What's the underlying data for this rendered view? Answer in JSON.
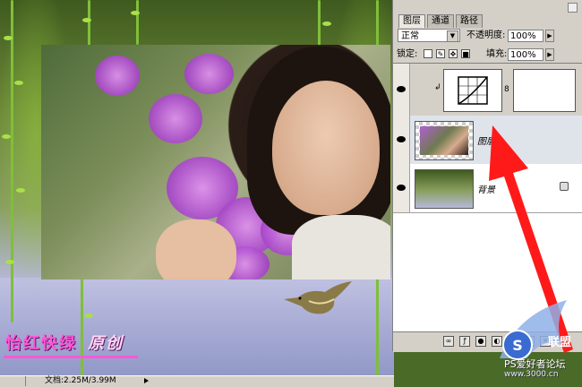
{
  "caption": {
    "main": "怡红快绿",
    "sub": "原创"
  },
  "status": {
    "doc_info": "文档:2.25M/3.99M"
  },
  "panel": {
    "tabs": [
      "图层",
      "通道",
      "路径"
    ],
    "blend_mode": "正常",
    "opacity_label": "不透明度:",
    "opacity_value": "100%",
    "lock_label": "锁定:",
    "fill_label": "填充:",
    "fill_value": "100%",
    "layers": [
      {
        "name": "",
        "type": "adjustment"
      },
      {
        "name": "图层",
        "type": "photo"
      },
      {
        "name": "背景",
        "type": "background"
      }
    ]
  },
  "watermark": {
    "site": "PS爱好者论坛",
    "url": "www.3000.cn"
  },
  "colors": {
    "annotation_arrow": "#ff1a1a",
    "caption": "#ff57d8"
  }
}
